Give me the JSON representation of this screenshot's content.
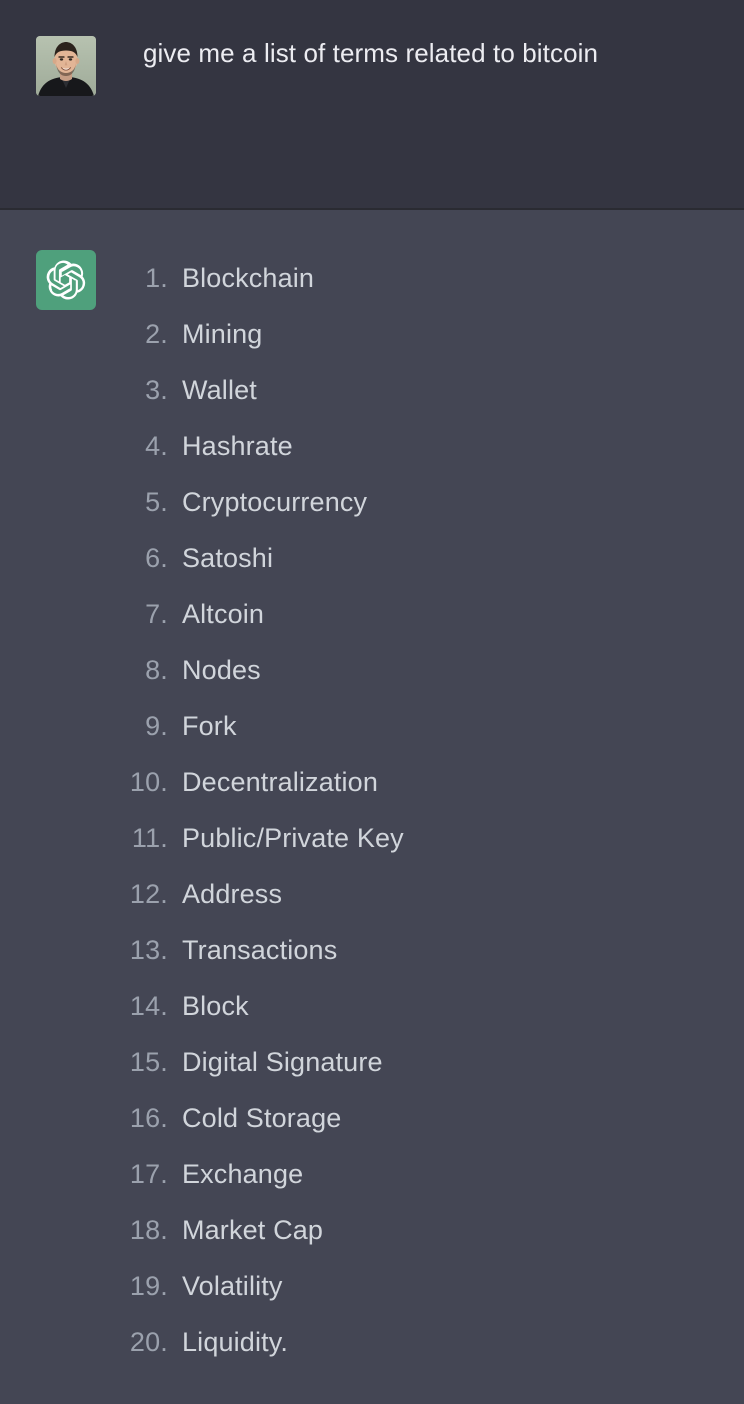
{
  "app": {
    "name": "ChatGPT",
    "theme": "dark",
    "colors": {
      "user_turn_background": "#343541",
      "assistant_turn_background": "#444654",
      "turn_divider": "#2a2b32",
      "user_text": "#ececf1",
      "list_number": "#9ba1ad",
      "list_text": "#d1d5db",
      "assistant_avatar_background": "#4fa07c",
      "assistant_avatar_glyph": "#ffffff"
    }
  },
  "conversation": {
    "user_turn": {
      "avatar": {
        "icon_name": "user-avatar-photo",
        "alt": "user profile photo"
      },
      "message": "give me a list of terms related to bitcoin"
    },
    "assistant_turn": {
      "avatar": {
        "icon_name": "openai-logo-icon",
        "alt": "ChatGPT assistant avatar"
      },
      "list": [
        {
          "number": "1.",
          "label": "Blockchain"
        },
        {
          "number": "2.",
          "label": "Mining"
        },
        {
          "number": "3.",
          "label": "Wallet"
        },
        {
          "number": "4.",
          "label": "Hashrate"
        },
        {
          "number": "5.",
          "label": "Cryptocurrency"
        },
        {
          "number": "6.",
          "label": "Satoshi"
        },
        {
          "number": "7.",
          "label": "Altcoin"
        },
        {
          "number": "8.",
          "label": "Nodes"
        },
        {
          "number": "9.",
          "label": "Fork"
        },
        {
          "number": "10.",
          "label": "Decentralization"
        },
        {
          "number": "11.",
          "label": "Public/Private Key"
        },
        {
          "number": "12.",
          "label": "Address"
        },
        {
          "number": "13.",
          "label": "Transactions"
        },
        {
          "number": "14.",
          "label": "Block"
        },
        {
          "number": "15.",
          "label": "Digital Signature"
        },
        {
          "number": "16.",
          "label": "Cold Storage"
        },
        {
          "number": "17.",
          "label": "Exchange"
        },
        {
          "number": "18.",
          "label": "Market Cap"
        },
        {
          "number": "19.",
          "label": "Volatility"
        },
        {
          "number": "20.",
          "label": "Liquidity."
        }
      ]
    }
  }
}
